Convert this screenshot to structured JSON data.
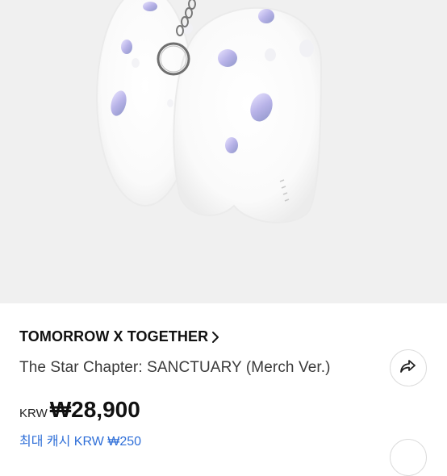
{
  "product": {
    "image_alt": "Plush keyring",
    "artist": "TOMORROW X TOGETHER",
    "title": "The Star Chapter: SANCTUARY (Merch Ver.)",
    "currency": "KRW",
    "price": "₩28,900",
    "max_cash": "최대 캐시 KRW ₩250"
  },
  "icons": {
    "artist_link": "chevron-right-icon",
    "share": "share-icon"
  }
}
